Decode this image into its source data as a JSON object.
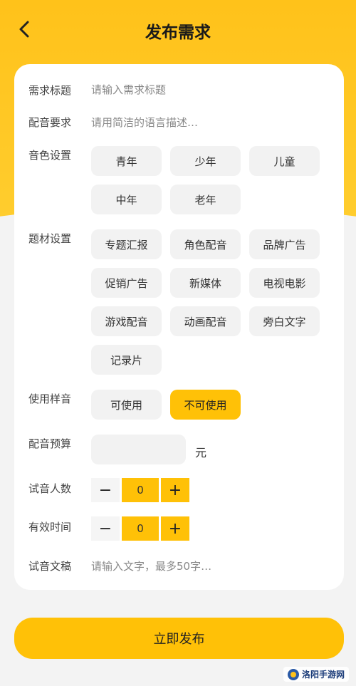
{
  "header": {
    "title": "发布需求",
    "back_icon": "chevron-left-icon"
  },
  "form": {
    "title_label": "需求标题",
    "title_placeholder": "请输入需求标题",
    "requirement_label": "配音要求",
    "requirement_placeholder": "请用简洁的语言描述…",
    "timbre_label": "音色设置",
    "timbre_options": [
      "青年",
      "少年",
      "儿童",
      "中年",
      "老年"
    ],
    "subject_label": "题材设置",
    "subject_options": [
      "专题汇报",
      "角色配音",
      "品牌广告",
      "促销广告",
      "新媒体",
      "电视电影",
      "游戏配音",
      "动画配音",
      "旁白文字",
      "记录片"
    ],
    "sample_label": "使用样音",
    "sample_options": [
      "可使用",
      "不可使用"
    ],
    "sample_selected": "不可使用",
    "budget_label": "配音预算",
    "budget_unit": "元",
    "testers_label": "试音人数",
    "testers_value": "0",
    "valid_time_label": "有效时间",
    "valid_time_value": "0",
    "text_label": "试音文稿",
    "text_placeholder": "请输入文字，最多50字…",
    "minus_symbol": "−",
    "plus_symbol": "+"
  },
  "submit_label": "立即发布",
  "watermark": {
    "text": "洛阳手游网"
  },
  "colors": {
    "accent": "#ffc107",
    "hero": "#ffc21a",
    "chip_bg": "#f2f2f2"
  }
}
